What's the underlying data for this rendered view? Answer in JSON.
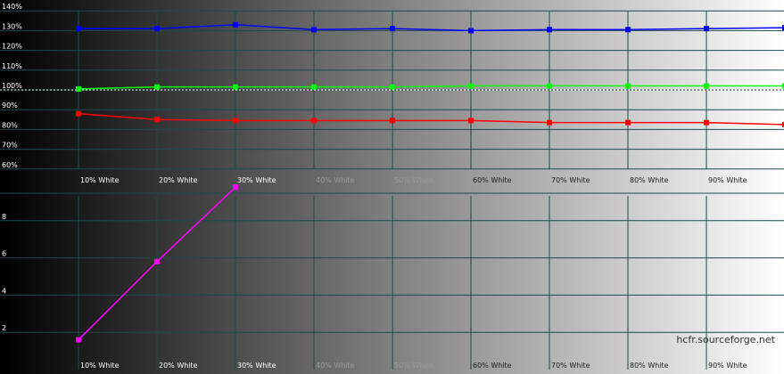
{
  "chart_data": [
    {
      "type": "line",
      "title": "",
      "xlabel": "",
      "ylabel": "",
      "categories": [
        "",
        "10% White",
        "20% White",
        "30% White",
        "40% White",
        "50% White",
        "60% White",
        "70% White",
        "80% White",
        "90% White",
        ""
      ],
      "y_tick_labels": [
        "140%",
        "130%",
        "120%",
        "110%",
        "100%",
        "90%",
        "80%",
        "70%",
        "60%"
      ],
      "ylim": [
        55,
        145
      ],
      "reference_value": 100,
      "grid": true,
      "series": [
        {
          "color": "#0000ff",
          "values": [
            null,
            131,
            131,
            133,
            130.5,
            131,
            130,
            130.5,
            130.5,
            131,
            131.5
          ]
        },
        {
          "color": "#00ff00",
          "values": [
            null,
            100.5,
            101.5,
            101.5,
            101.5,
            101.5,
            102,
            102,
            102,
            102,
            102
          ]
        },
        {
          "color": "#ff0000",
          "values": [
            null,
            88,
            85,
            84.5,
            84.5,
            84.5,
            84.5,
            83.5,
            83.5,
            83.5,
            82.5
          ]
        }
      ]
    },
    {
      "type": "line",
      "title": "",
      "xlabel": "",
      "ylabel": "",
      "categories": [
        "",
        "10% White",
        "20% White",
        "30% White",
        "40% White",
        "50% White",
        "60% White",
        "70% White",
        "80% White",
        "90% White",
        ""
      ],
      "y_tick_labels": [
        "8",
        "6",
        "4",
        "2"
      ],
      "ylim": [
        0,
        10
      ],
      "grid": true,
      "series": [
        {
          "color": "#ff00ff",
          "values": [
            null,
            1.6,
            5.8,
            9.8,
            null,
            null,
            null,
            null,
            null,
            null,
            null
          ]
        }
      ]
    }
  ],
  "watermark": "hcfr.sourceforge.net"
}
